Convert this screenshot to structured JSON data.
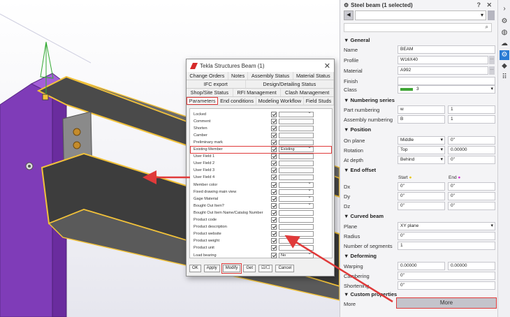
{
  "dialog": {
    "title": "Tekla Structures  Beam (1)",
    "tabs_row1": [
      "Change Orders",
      "Notes",
      "Assembly Status",
      "Material Status"
    ],
    "tabs_row2": [
      "IFC export",
      "Design/Detailing Status"
    ],
    "tabs_row3": [
      "Shop/Site Status",
      "RFI Management",
      "Clash Management"
    ],
    "tabs_row4": [
      "Parameters",
      "End conditions",
      "Modeling Workflow",
      "Field Studs"
    ],
    "params": [
      {
        "label": "Locked",
        "value": "",
        "dropdown": true
      },
      {
        "label": "Comment",
        "value": "",
        "dropdown": false
      },
      {
        "label": "Shorten",
        "value": "",
        "dropdown": false
      },
      {
        "label": "Camber",
        "value": "",
        "dropdown": false
      },
      {
        "label": "Preliminary mark",
        "value": "",
        "dropdown": false
      },
      {
        "label": "Existing Member",
        "value": "Existing",
        "dropdown": true
      },
      {
        "label": "User Field 1",
        "value": "",
        "dropdown": false
      },
      {
        "label": "User Field 2",
        "value": "",
        "dropdown": false
      },
      {
        "label": "User Field 3",
        "value": "",
        "dropdown": false
      },
      {
        "label": "User Field 4",
        "value": "",
        "dropdown": false
      },
      {
        "label": "Member color",
        "value": "",
        "dropdown": true
      },
      {
        "label": "Fixed drawing main view",
        "value": "",
        "dropdown": true
      },
      {
        "label": "Gage Material",
        "value": "",
        "dropdown": true
      },
      {
        "label": "Bought Out Item?",
        "value": "",
        "dropdown": true
      },
      {
        "label": "Bought Out Item Name/Catalog Number",
        "value": "",
        "dropdown": false
      },
      {
        "label": "Product code",
        "value": "",
        "dropdown": false
      },
      {
        "label": "Product description",
        "value": "",
        "dropdown": false
      },
      {
        "label": "Product website",
        "value": "",
        "dropdown": false
      },
      {
        "label": "Product weight",
        "value": "",
        "dropdown": false
      },
      {
        "label": "Product unit",
        "value": "",
        "dropdown": false
      },
      {
        "label": "Load bearing",
        "value": "No",
        "dropdown": true
      }
    ],
    "buttons": {
      "ok": "OK",
      "apply": "Apply",
      "modify": "Modify",
      "get": "Get",
      "toggle": "☑/☐",
      "cancel": "Cancel"
    }
  },
  "panel": {
    "title": "Steel beam (1 selected)",
    "header_icons": "?  ✕",
    "search_icon": "search-icon",
    "general": {
      "heading": "General",
      "name_label": "Name",
      "name": "BEAM",
      "profile_label": "Profile",
      "profile": "W16X40",
      "material_label": "Material",
      "material": "A992",
      "finish_label": "Finish",
      "finish": "",
      "class_label": "Class",
      "class": "3",
      "class_color": "#3fa535"
    },
    "numbering": {
      "heading": "Numbering series",
      "part_label": "Part numbering",
      "part_prefix": "w",
      "part_start": "1",
      "assembly_label": "Assembly numbering",
      "assembly_prefix": "B",
      "assembly_start": "1"
    },
    "position": {
      "heading": "Position",
      "on_plane_label": "On plane",
      "on_plane": "Middle",
      "on_plane_val": "0\"",
      "rotation_label": "Rotation",
      "rotation": "Top",
      "rotation_val": "0.00000",
      "depth_label": "At depth",
      "depth": "Behind",
      "depth_val": "0\""
    },
    "end_offset": {
      "heading": "End offset",
      "start_label": "Start",
      "end_label": "End",
      "dx_label": "Dx",
      "dx_start": "0\"",
      "dx_end": "0\"",
      "dy_label": "Dy",
      "dy_start": "0\"",
      "dy_end": "0\"",
      "dz_label": "Dz",
      "dz_start": "0\"",
      "dz_end": "0\""
    },
    "curved": {
      "heading": "Curved beam",
      "plane_label": "Plane",
      "plane": "XY plane",
      "radius_label": "Radius",
      "radius": "0\"",
      "segments_label": "Number of segments",
      "segments": "1"
    },
    "deforming": {
      "heading": "Deforming",
      "warping_label": "Warping",
      "warping_start": "0.00000",
      "warping_end": "0.00000",
      "cambering_label": "Cambering",
      "cambering": "0\"",
      "shortening_label": "Shortening",
      "shortening": "0\""
    },
    "custom": {
      "heading": "Custom properties",
      "more_label": "More",
      "more_button": "More"
    }
  },
  "strip_icons": [
    "chevron-right-icon",
    "settings-search-icon",
    "globe-icon",
    "cloud-icon",
    "gear-icon",
    "cube-icon",
    "grid-icon"
  ],
  "colors": {
    "accent": "#2a7bd4",
    "highlight": "#e03a3a",
    "steel_purple": "#8a3fc0"
  }
}
